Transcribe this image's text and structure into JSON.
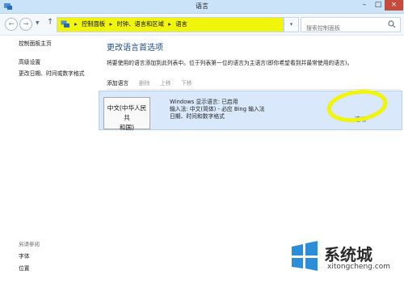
{
  "window": {
    "title": "语言"
  },
  "nav": {
    "breadcrumbs": [
      "控制面板",
      "时钟、语言和区域",
      "语言"
    ],
    "search_placeholder": "搜索控制面板"
  },
  "sidebar": {
    "home": "控制面板主页",
    "links": [
      "高级设置",
      "更改日期、时间或数字格式"
    ],
    "see_also_label": "另请参阅",
    "see_also": [
      "字体",
      "位置"
    ]
  },
  "main": {
    "heading": "更改语言首选项",
    "description": "将要使用的语言添加到此列表中。位于列表第一位的语言为主语言(即你希望看到并最常使用的语言)。",
    "toolbar": {
      "add": "添加语言",
      "remove": "删除",
      "up": "上移",
      "down": "下移"
    },
    "language": {
      "name_line1": "中文(中华人民共",
      "name_line2": "和国)",
      "details": [
        "Windows 显示语言: 已启用",
        "输入法: 中文(简体) - 必应 Bing 输入法",
        "日期、时间和数字格式"
      ],
      "options_link": "选项"
    }
  },
  "watermark": {
    "brand": "系统城",
    "url": "xitongcheng.com"
  },
  "colors": {
    "highlight": "#f1f40b",
    "accent_link": "#1f5bb5",
    "heading": "#1f4e86",
    "selected_row": "#d9e8fb"
  }
}
